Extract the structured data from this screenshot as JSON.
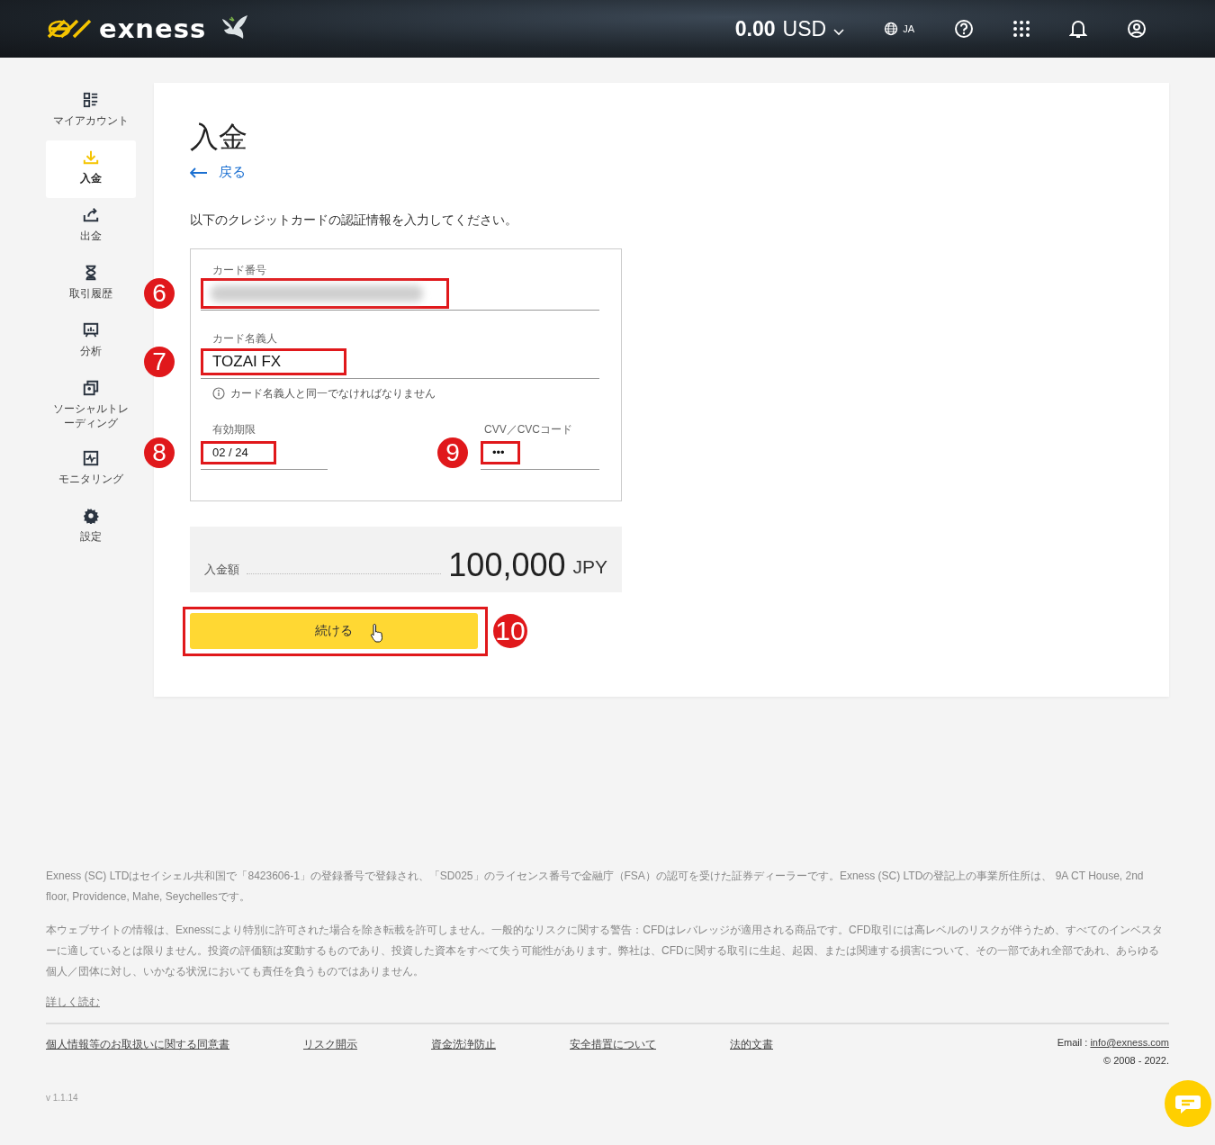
{
  "header": {
    "logo": "exness",
    "balance": {
      "amount": "0.00",
      "currency": "USD"
    },
    "language": "JA"
  },
  "sidebar": {
    "items": [
      {
        "label": "マイアカウント",
        "selected": false
      },
      {
        "label": "入金",
        "selected": true
      },
      {
        "label": "出金",
        "selected": false
      },
      {
        "label": "取引履歴",
        "selected": false
      },
      {
        "label": "分析",
        "selected": false
      },
      {
        "label": "ソーシャルトレーディング",
        "selected": false
      },
      {
        "label": "モニタリング",
        "selected": false
      },
      {
        "label": "設定",
        "selected": false
      }
    ]
  },
  "page": {
    "title": "入金",
    "back_link": "戻る",
    "instruction": "以下のクレジットカードの認証情報を入力してください。"
  },
  "card_form": {
    "rows": [
      [
        {
          "label": "カード番号",
          "blurred": true,
          "annotation": "6"
        }
      ],
      [
        {
          "label": "カード名義人",
          "value": "TOZAI FX",
          "blurred": false,
          "annotation": "7",
          "hint": "カード名義人と同一でなければなりません"
        }
      ],
      [
        {
          "label": "有効期限",
          "value": "02 / 24",
          "blurred": false,
          "annotation": "8"
        },
        {
          "label": "CVV／CVCコード",
          "value": "•••",
          "blurred": false,
          "annotation": "9"
        }
      ]
    ]
  },
  "amount": {
    "label": "入金額",
    "value": "100,000",
    "currency": "JPY"
  },
  "continue_button": {
    "label": "続ける",
    "annotation": "10"
  },
  "footer": {
    "paragraphs": [
      "Exness (SC) LTDはセイシェル共和国で「8423606-1」の登録番号で登録され、「SD025」のライセンス番号で金融庁（FSA）の認可を受けた証券ディーラーです。Exness (SC) LTDの登記上の事業所住所は、 9A CT House, 2nd floor, Providence, Mahe, Seychellesです。",
      "本ウェブサイトの情報は、Exnessにより特別に許可された場合を除き転載を許可しません。一般的なリスクに関する警告：CFDはレバレッジが適用される商品です。CFD取引には高レベルのリスクが伴うため、すべてのインベスターに適しているとは限りません。投資の評価額は変動するものであり、投資した資本をすべて失う可能性があります。弊社は、CFDに関する取引に生起、起因、または関連する損害について、その一部であれ全部であれ、あらゆる個人／団体に対し、いかなる状況においても責任を負うものではありません。"
    ],
    "read_more": "詳しく読む",
    "links": [
      "個人情報等のお取扱いに関する同意書",
      "リスク開示",
      "資金洗浄防止",
      "安全措置について",
      "法的文書"
    ],
    "email_label": "Email :",
    "email": "info@exness.com",
    "copyright": "© 2008 - 2022.",
    "version": "v 1.1.14"
  }
}
